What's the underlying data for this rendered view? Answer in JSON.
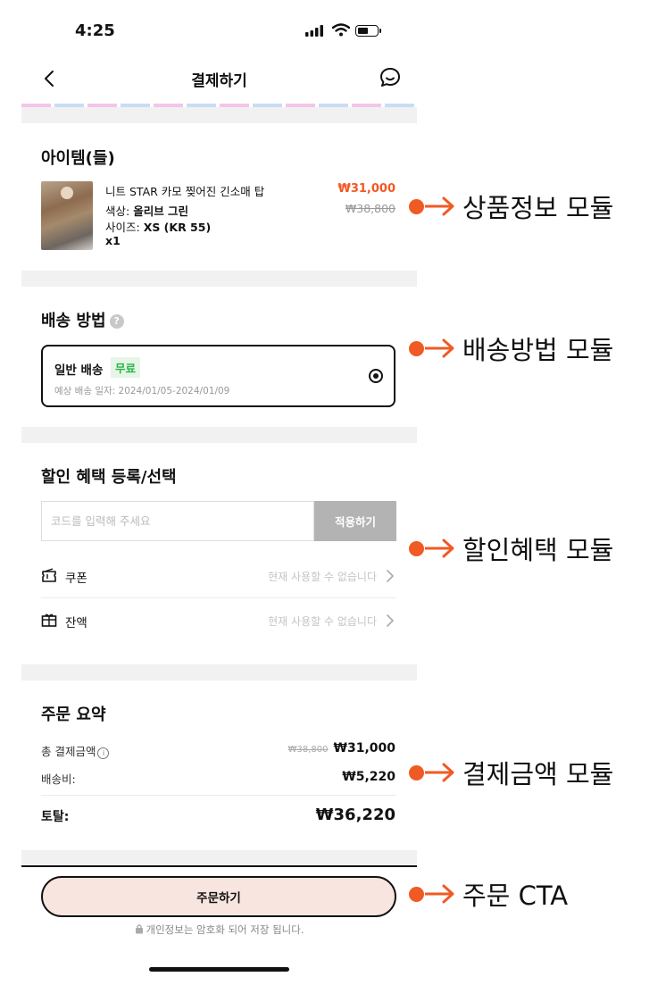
{
  "status_bar": {
    "time": "4:25"
  },
  "header": {
    "title": "결제하기"
  },
  "items_section": {
    "title": "아이템(들)",
    "item": {
      "name": "니트 STAR 카모 찢어진 긴소매 탑",
      "color_label": "색상: ",
      "color_value": "올리브 그린",
      "size_label": "사이즈: ",
      "size_value": "XS (KR 55)",
      "quantity": "x1",
      "sale_price": "₩31,000",
      "original_price": "₩38,800"
    }
  },
  "shipping_section": {
    "title": "배송 방법",
    "help_icon": "?",
    "option": {
      "name": "일반 배송",
      "badge": "무료",
      "eta": "예상 배송 일자: 2024/01/05-2024/01/09",
      "selected": true
    }
  },
  "discount_section": {
    "title": "할인 혜택 등록/선택",
    "code_placeholder": "코드를 입력해 주세요",
    "apply_label": "적용하기",
    "rows": [
      {
        "icon": "coupon-icon",
        "label": "쿠폰",
        "status": "현재 사용할 수 없습니다"
      },
      {
        "icon": "balance-icon",
        "label": "잔액",
        "status": "현재 사용할 수 없습니다"
      }
    ]
  },
  "summary_section": {
    "title": "주문 요약",
    "total_payment_label": "총 결제금액",
    "info_icon": "i",
    "total_payment_original": "₩38,800",
    "total_payment_value": "₩31,000",
    "shipping_label": "배송비:",
    "shipping_value": "₩5,220",
    "grand_total_label": "토탈:",
    "grand_total_value": "₩36,220"
  },
  "footer": {
    "order_button": "주문하기",
    "secure_note": "개인정보는 암호화 되어 저장 됩니다."
  },
  "annotations": [
    "상품정보 모듈",
    "배송방법 모듈",
    "할인혜택 모듈",
    "결제금액 모듈",
    "주문 CTA"
  ],
  "colors": {
    "accent": "#f05a24",
    "cta_background": "#f9e5df",
    "free_badge": "#2bb34b",
    "apply_button": "#b3b3b3"
  }
}
